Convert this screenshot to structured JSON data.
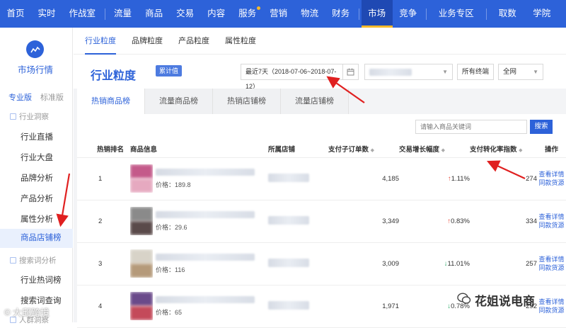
{
  "topnav": {
    "items": [
      {
        "label": "首页"
      },
      {
        "label": "实时"
      },
      {
        "label": "作战室"
      },
      {
        "label": "流量"
      },
      {
        "label": "商品"
      },
      {
        "label": "交易"
      },
      {
        "label": "内容"
      },
      {
        "label": "服务"
      },
      {
        "label": "营销"
      },
      {
        "label": "物流"
      },
      {
        "label": "财务"
      },
      {
        "label": "市场"
      },
      {
        "label": "竞争"
      },
      {
        "label": "业务专区"
      },
      {
        "label": "取数"
      },
      {
        "label": "学院"
      }
    ],
    "active": "市场",
    "accent": "#2d62d9",
    "active_indicator": "#f5b92a"
  },
  "sidebar": {
    "title": "市场行情",
    "logo_icon": "chart-line-icon",
    "version_pro": "专业版",
    "version_std": "标准版",
    "group1": "行业洞察",
    "group1_items": [
      "行业直播",
      "行业大盘",
      "品牌分析",
      "产品分析",
      "属性分析",
      "商品店铺榜"
    ],
    "group2": "搜索词分析",
    "group2_items": [
      "行业热词榜",
      "搜索词查询"
    ],
    "group3": "人群洞察",
    "active_item": "商品店铺榜"
  },
  "granularity_tabs": [
    "行业粒度",
    "品牌粒度",
    "产品粒度",
    "属性粒度"
  ],
  "header": {
    "title": "行业粒度",
    "badge": "累计值",
    "date_range": "最近7天（2018-07-06~2018-07-12）",
    "terminal_select": "所有终端",
    "network_select": "全网"
  },
  "list_tabs": [
    "热销商品榜",
    "流量商品榜",
    "热销店铺榜",
    "流量店铺榜"
  ],
  "search": {
    "placeholder": "请输入商品关键词",
    "button": "搜索"
  },
  "table": {
    "columns": [
      "热销排名",
      "商品信息",
      "所属店铺",
      "支付子订单数",
      "交易增长幅度",
      "支付转化率指数",
      "操作"
    ],
    "rows": [
      {
        "rank": "1",
        "price": "价格：189.8",
        "orders": "4,185",
        "growth": "1.11%",
        "growth_dir": "up",
        "conversion": "274"
      },
      {
        "rank": "2",
        "price": "价格：29.6",
        "orders": "3,349",
        "growth": "0.83%",
        "growth_dir": "up",
        "conversion": "334"
      },
      {
        "rank": "3",
        "price": "价格：116",
        "orders": "3,009",
        "growth": "11.01%",
        "growth_dir": "down",
        "conversion": "257"
      },
      {
        "rank": "4",
        "price": "价格：65",
        "orders": "1,971",
        "growth": "0.78%",
        "growth_dir": "down",
        "conversion": "292"
      }
    ],
    "action_details": "查看详情",
    "action_similar": "同款货源"
  },
  "watermarks": {
    "left": "大邱跨境",
    "right": "花姐说电商"
  }
}
